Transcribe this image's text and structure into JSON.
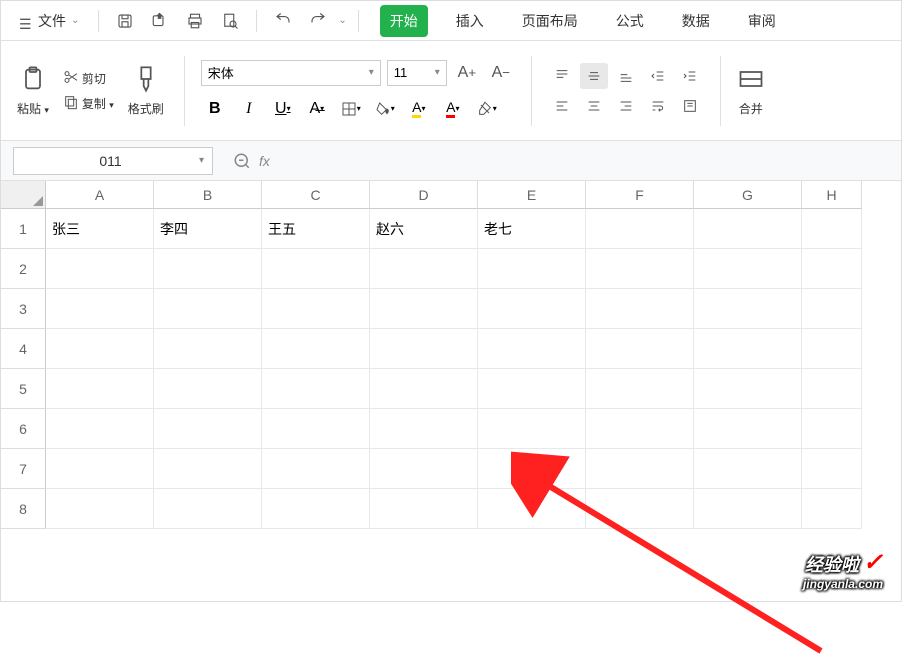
{
  "topbar": {
    "file_label": "文件"
  },
  "tabs": {
    "start": "开始",
    "insert": "插入",
    "layout": "页面布局",
    "formula": "公式",
    "data": "数据",
    "review": "审阅"
  },
  "ribbon": {
    "paste": "粘贴",
    "cut": "剪切",
    "copy": "复制",
    "format_painter": "格式刷",
    "font_name": "宋体",
    "font_size": "11",
    "merge": "合并"
  },
  "namebox": {
    "value": "011"
  },
  "columns": [
    "A",
    "B",
    "C",
    "D",
    "E",
    "F",
    "G",
    "H"
  ],
  "rows": [
    "1",
    "2",
    "3",
    "4",
    "5",
    "6",
    "7",
    "8"
  ],
  "cells": {
    "A1": "张三",
    "B1": "李四",
    "C1": "王五",
    "D1": "赵六",
    "E1": "老七"
  },
  "watermark": {
    "line1": "经验啦",
    "line2": "jingyanla.com"
  }
}
